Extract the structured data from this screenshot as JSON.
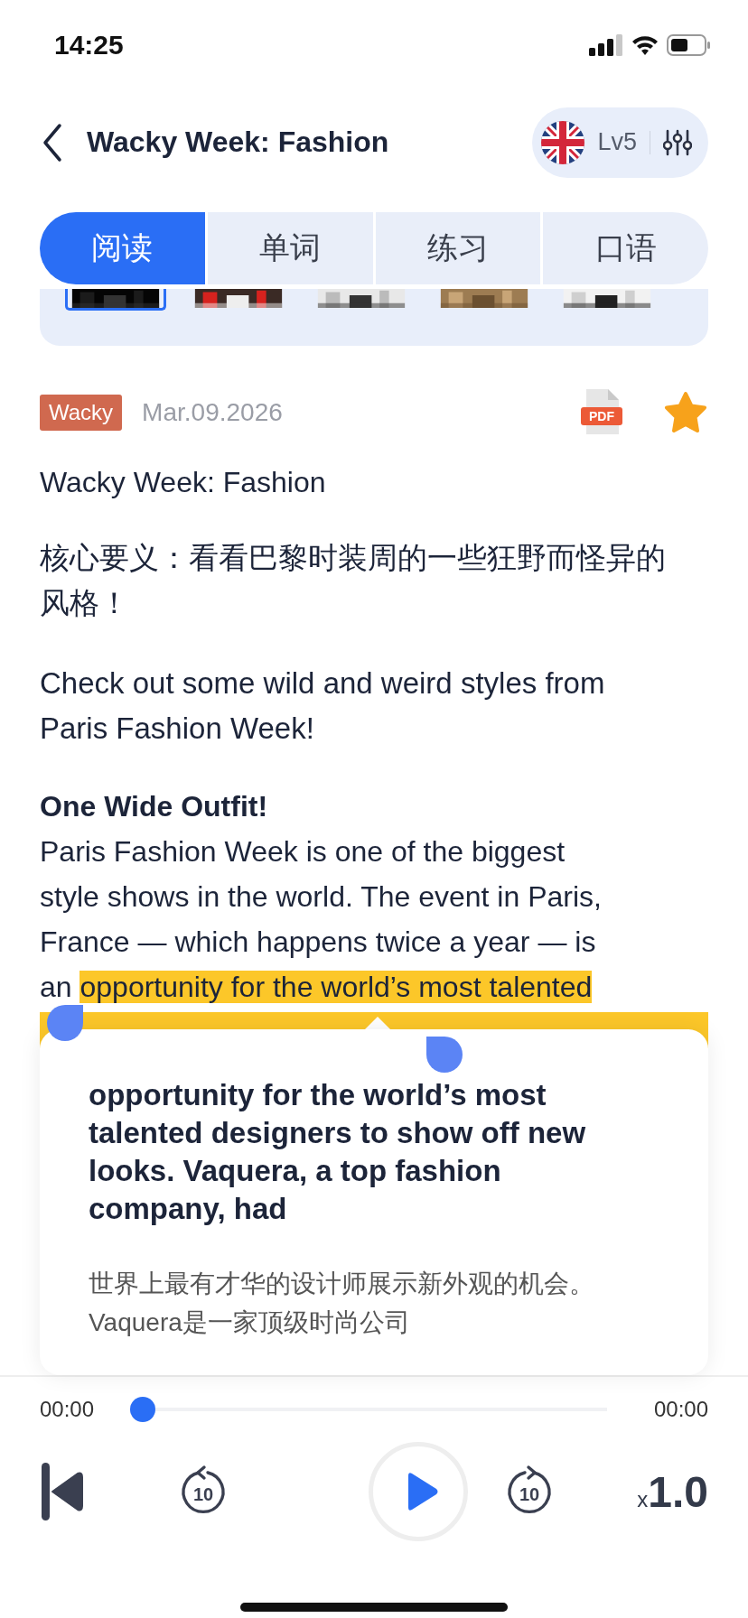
{
  "status_bar": {
    "time": "14:25"
  },
  "header": {
    "title": "Wacky Week: Fashion",
    "level": "Lv5"
  },
  "tabs": [
    {
      "label": "阅读",
      "selected": true
    },
    {
      "label": "单词",
      "selected": false
    },
    {
      "label": "练习",
      "selected": false
    },
    {
      "label": "口语",
      "selected": false
    }
  ],
  "thumbnails": [
    {
      "kind": "picture",
      "selected": true
    },
    {
      "kind": "picture",
      "selected": false
    },
    {
      "kind": "picture",
      "selected": false
    },
    {
      "kind": "picture",
      "selected": false
    },
    {
      "kind": "picture",
      "selected": false
    }
  ],
  "article": {
    "tag": "Wacky",
    "date": "Mar.09.2026",
    "pdf_label": "PDF",
    "favorite": true,
    "title": "Wacky Week: Fashion",
    "summary_zh": "核心要义：看看巴黎时装周的一些狂野而怪异的风格！",
    "summary_en": "Check out some wild and weird styles from Paris Fashion Week!",
    "heading": "One Wide Outfit!",
    "paragraph": [
      {
        "text": "Paris Fashion Week is one of the biggest\nstyle shows in the world. The event in Paris,\nFrance — which happens twice a year — is\nan ",
        "highlighted": false
      },
      {
        "text": "opportunity for the world’s most talented",
        "highlighted": true
      }
    ]
  },
  "popup": {
    "text": "opportunity for the world’s most talented designers to show off new looks. Vaquera, a top fashion company, had",
    "translation": "世界上最有才华的设计师展示新外观的机会。Vaquera是一家顶级时尚公司"
  },
  "player": {
    "elapsed": "00:00",
    "total": "00:00",
    "progress": {
      "level": 0
    },
    "rewind_label": "10",
    "forward_label": "10",
    "speed": {
      "prefix": "x",
      "value": "1.0"
    }
  }
}
